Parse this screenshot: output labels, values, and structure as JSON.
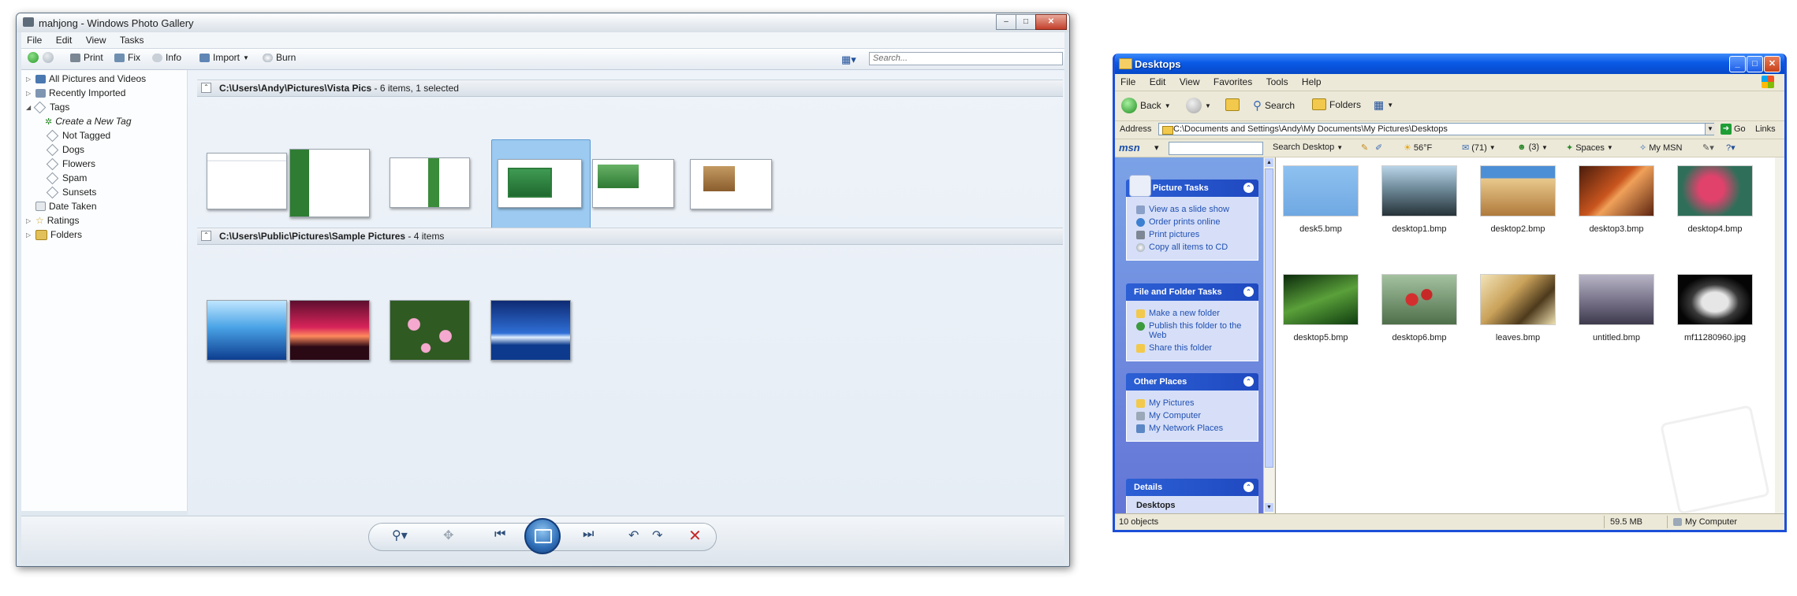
{
  "photo_gallery": {
    "title": "mahjong - Windows Photo Gallery",
    "menu": [
      "File",
      "Edit",
      "View",
      "Tasks"
    ],
    "toolbar": {
      "print": "Print",
      "fix": "Fix",
      "info": "Info",
      "import": "Import",
      "burn": "Burn"
    },
    "search_placeholder": "Search...",
    "nav": {
      "all_pictures": "All Pictures and Videos",
      "recently_imported": "Recently Imported",
      "tags": "Tags",
      "create_tag": "Create a New Tag",
      "tag_items": [
        "Not Tagged",
        "Dogs",
        "Flowers",
        "Spam",
        "Sunsets"
      ],
      "date_taken": "Date Taken",
      "ratings": "Ratings",
      "folders": "Folders"
    },
    "groups": [
      {
        "path": "C:\\Users\\Andy\\Pictures\\Vista Pics",
        "meta": " - 6 items, 1 selected"
      },
      {
        "path": "C:\\Users\\Public\\Pictures\\Sample Pictures",
        "meta": " - 4 items"
      }
    ]
  },
  "explorer": {
    "title": "Desktops",
    "menu": [
      "File",
      "Edit",
      "View",
      "Favorites",
      "Tools",
      "Help"
    ],
    "toolbar": {
      "back": "Back",
      "search": "Search",
      "folders": "Folders"
    },
    "address_label": "Address",
    "address_value": "C:\\Documents and Settings\\Andy\\My Documents\\My Pictures\\Desktops",
    "go": "Go",
    "links": "Links",
    "msn": {
      "logo": "msn",
      "search": "Search Desktop",
      "weather": "56°F",
      "mail": "(71)",
      "contacts": "(3)",
      "spaces": "Spaces",
      "mymsn": "My MSN"
    },
    "picture_tasks": {
      "title": "Picture Tasks",
      "items": [
        "View as a slide show",
        "Order prints online",
        "Print pictures",
        "Copy all items to CD"
      ]
    },
    "file_tasks": {
      "title": "File and Folder Tasks",
      "items": [
        "Make a new folder",
        "Publish this folder to the Web",
        "Share this folder"
      ]
    },
    "other_places": {
      "title": "Other Places",
      "items": [
        "My Pictures",
        "My Computer",
        "My Network Places"
      ]
    },
    "details": {
      "title": "Details",
      "name": "Desktops"
    },
    "files": [
      "desk5.bmp",
      "desktop1.bmp",
      "desktop2.bmp",
      "desktop3.bmp",
      "desktop4.bmp",
      "desktop5.bmp",
      "desktop6.bmp",
      "leaves.bmp",
      "untitled.bmp",
      "mf11280960.jpg"
    ],
    "status": {
      "objects": "10 objects",
      "size": "59.5 MB",
      "location": "My Computer"
    }
  }
}
